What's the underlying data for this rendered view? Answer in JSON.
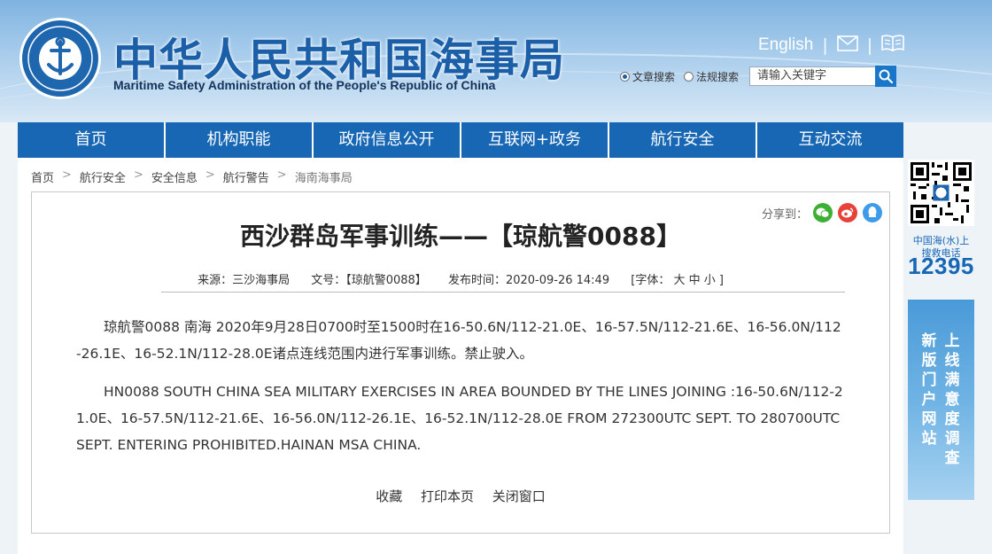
{
  "header": {
    "logo_top_text": "中国海事",
    "logo_bottom_text": "CHINA MSA",
    "title_cn": "中华人民共和国海事局",
    "title_en": "Maritime Safety Administration of the People's Republic of China",
    "english_link": "English",
    "search": {
      "option_article": "文章搜索",
      "option_law": "法规搜索",
      "placeholder": "请输入关键字"
    }
  },
  "nav": {
    "items": [
      "首页",
      "机构职能",
      "政府信息公开",
      "互联网+政务",
      "航行安全",
      "互动交流"
    ]
  },
  "breadcrumb": [
    "首页",
    "航行安全",
    "安全信息",
    "航行警告",
    "海南海事局"
  ],
  "article": {
    "share_label": "分享到：",
    "title": "西沙群岛军事训练——【琼航警0088】",
    "meta": {
      "source": "来源：三沙海事局",
      "doc_no": "文号：【琼航警0088】",
      "date": "发布时间：2020-09-26 14:49",
      "font_size": "[字体：  大   中   小 ]"
    },
    "para_cn": "琼航警0088 南海 2020年9月28日0700时至1500时在16-50.6N/112-21.0E、16-57.5N/112-21.6E、16-56.0N/112-26.1E、16-52.1N/112-28.0E诸点连线范围内进行军事训练。禁止驶入。",
    "para_en": "HN0088 SOUTH CHINA SEA MILITARY EXERCISES IN AREA BOUNDED BY THE LINES JOINING :16-50.6N/112-21.0E、16-57.5N/112-21.6E、16-56.0N/112-26.1E、16-52.1N/112-28.0E FROM 272300UTC SEPT. TO 280700UTC SEPT. ENTERING PROHIBITED.HAINAN MSA CHINA.",
    "actions": [
      "收藏",
      "打印本页",
      "关闭窗口"
    ]
  },
  "sidebar": {
    "hotline_label_1": "中国海(水)上",
    "hotline_label_2": "搜救电话",
    "hotline_number": "12395",
    "banner_col_1": "新版门户网站",
    "banner_col_2": "上线满意度调查"
  },
  "colors": {
    "nav_bg": "#1767b4",
    "brand_blue": "#1a5fa8",
    "wechat": "#3cb034",
    "weibo": "#e6423a",
    "qq": "#3d9be9"
  }
}
